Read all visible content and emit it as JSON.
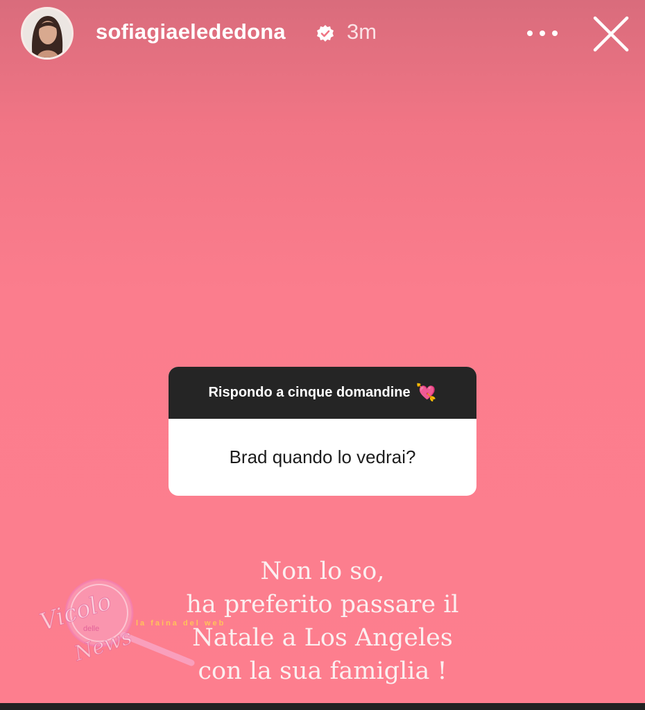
{
  "story": {
    "username": "sofiagiaelededona",
    "time": "3m",
    "question_sticker": {
      "prompt": "Rispondo a cinque domandine",
      "prompt_emoji": "💘",
      "question": "Brad quando lo vedrai?"
    },
    "answer_lines": [
      "Non lo so,",
      "ha preferito passare il",
      "Natale a Los Angeles",
      "con la sua famiglia !"
    ],
    "watermark": {
      "line1": "Vicolo",
      "line2": "delle",
      "line3": "News",
      "tagline": "la faina del web"
    }
  },
  "icons": {
    "verified": "verified-badge-icon",
    "more": "more-options-icon",
    "close": "close-icon"
  },
  "colors": {
    "background": "#fd7e8e",
    "sticker_header": "#252525",
    "text": "#ffffff"
  }
}
